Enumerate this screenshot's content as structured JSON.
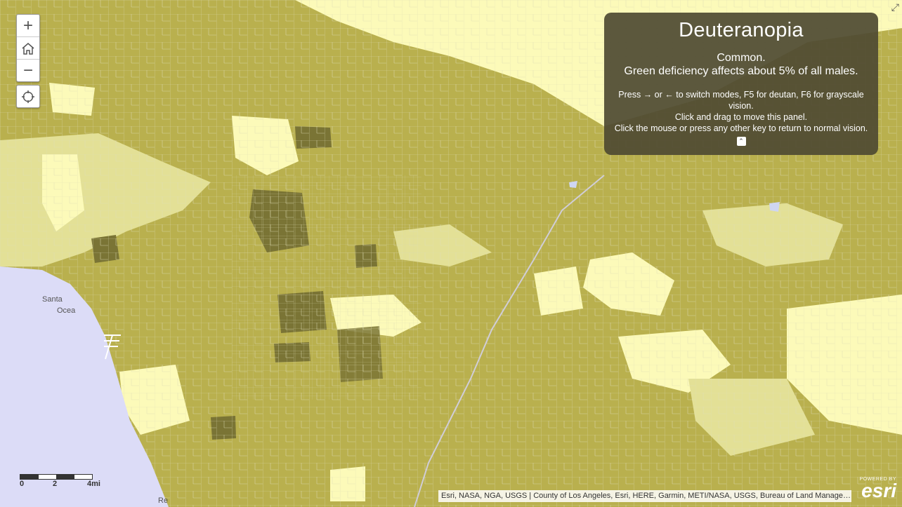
{
  "colors": {
    "water": "#dcdcf7",
    "class_light": "#fcfab9",
    "class_mid_light": "#e3e096",
    "class_mid": "#b9b04e",
    "class_dark": "#7a7435",
    "boundary": "#e8e6c8",
    "panel_bg": "rgba(78,74,50,0.92)"
  },
  "controls": {
    "zoom_in": "+",
    "home_icon": "home-icon",
    "zoom_out": "−",
    "locate_icon": "locate-icon"
  },
  "panel": {
    "title": "Deuteranopia",
    "line1": "Common.",
    "line2": "Green deficiency affects about 5% of all males.",
    "instructions1": "Press → or ← to switch modes, F5 for deutan, F6 for grayscale vision.",
    "instructions2": "Click and drag to move this panel.",
    "instructions3": "Click the mouse or press any other key to return to normal vision.",
    "collapse": "⌃"
  },
  "scalebar": {
    "zero": "0",
    "mid": "2",
    "end": "4mi"
  },
  "map_labels": {
    "santa": "Santa",
    "ocean": "Ocea",
    "bottom": "Re"
  },
  "attribution": "Esri, NASA, NGA, USGS | County of Los Angeles, Esri, HERE, Garmin, METI/NASA, USGS, Bureau of Land Management, EPA, ...",
  "esri": {
    "powered": "POWERED BY",
    "logo": "esri"
  },
  "expand_icon": "⤢"
}
